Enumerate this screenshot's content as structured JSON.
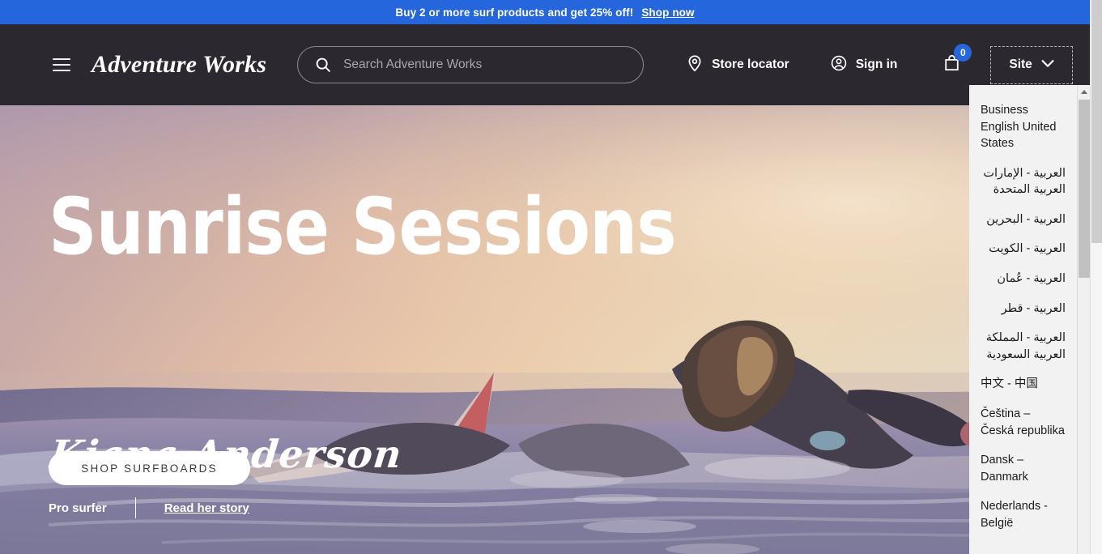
{
  "promo": {
    "text": "Buy 2 or more surf products and get 25% off!",
    "link_label": "Shop now",
    "background_color": "#2566dc"
  },
  "header": {
    "background_color": "#2b2830",
    "menu_icon": "hamburger-icon",
    "brand": "Adventure Works",
    "search": {
      "placeholder": "Search Adventure Works",
      "value": "",
      "icon": "search-icon"
    },
    "store_locator": {
      "label": "Store locator",
      "icon": "location-pin-icon"
    },
    "sign_in": {
      "label": "Sign in",
      "icon": "account-circle-icon"
    },
    "cart": {
      "icon": "shopping-bag-icon",
      "count": "0",
      "badge_color": "#2566dc"
    },
    "site_selector": {
      "label": "Site",
      "icon": "chevron-down-icon",
      "expanded": true
    }
  },
  "hero": {
    "title": "Sunrise Sessions",
    "signature": "Kiana Anderson",
    "role": "Pro surfer",
    "story_link": "Read her story",
    "cta_label": "SHOP SURFBOARDS",
    "image_alt": "Surfer paddling on a wave at sunrise"
  },
  "site_dropdown": {
    "options": [
      {
        "label": "Business English United States",
        "rtl": false
      },
      {
        "label": "العربية - الإمارات العربية المتحدة",
        "rtl": true
      },
      {
        "label": "العربية - البحرين",
        "rtl": true
      },
      {
        "label": "العربية - الكويت",
        "rtl": true
      },
      {
        "label": "العربية - عُمان",
        "rtl": true
      },
      {
        "label": "العربية - قطر",
        "rtl": true
      },
      {
        "label": "العربية - المملكة العربية السعودية",
        "rtl": true
      },
      {
        "label": "中文 - 中国",
        "rtl": false
      },
      {
        "label": "Čeština – Česká republika",
        "rtl": false
      },
      {
        "label": "Dansk – Danmark",
        "rtl": false
      },
      {
        "label": "Nederlands - België",
        "rtl": false
      }
    ]
  }
}
